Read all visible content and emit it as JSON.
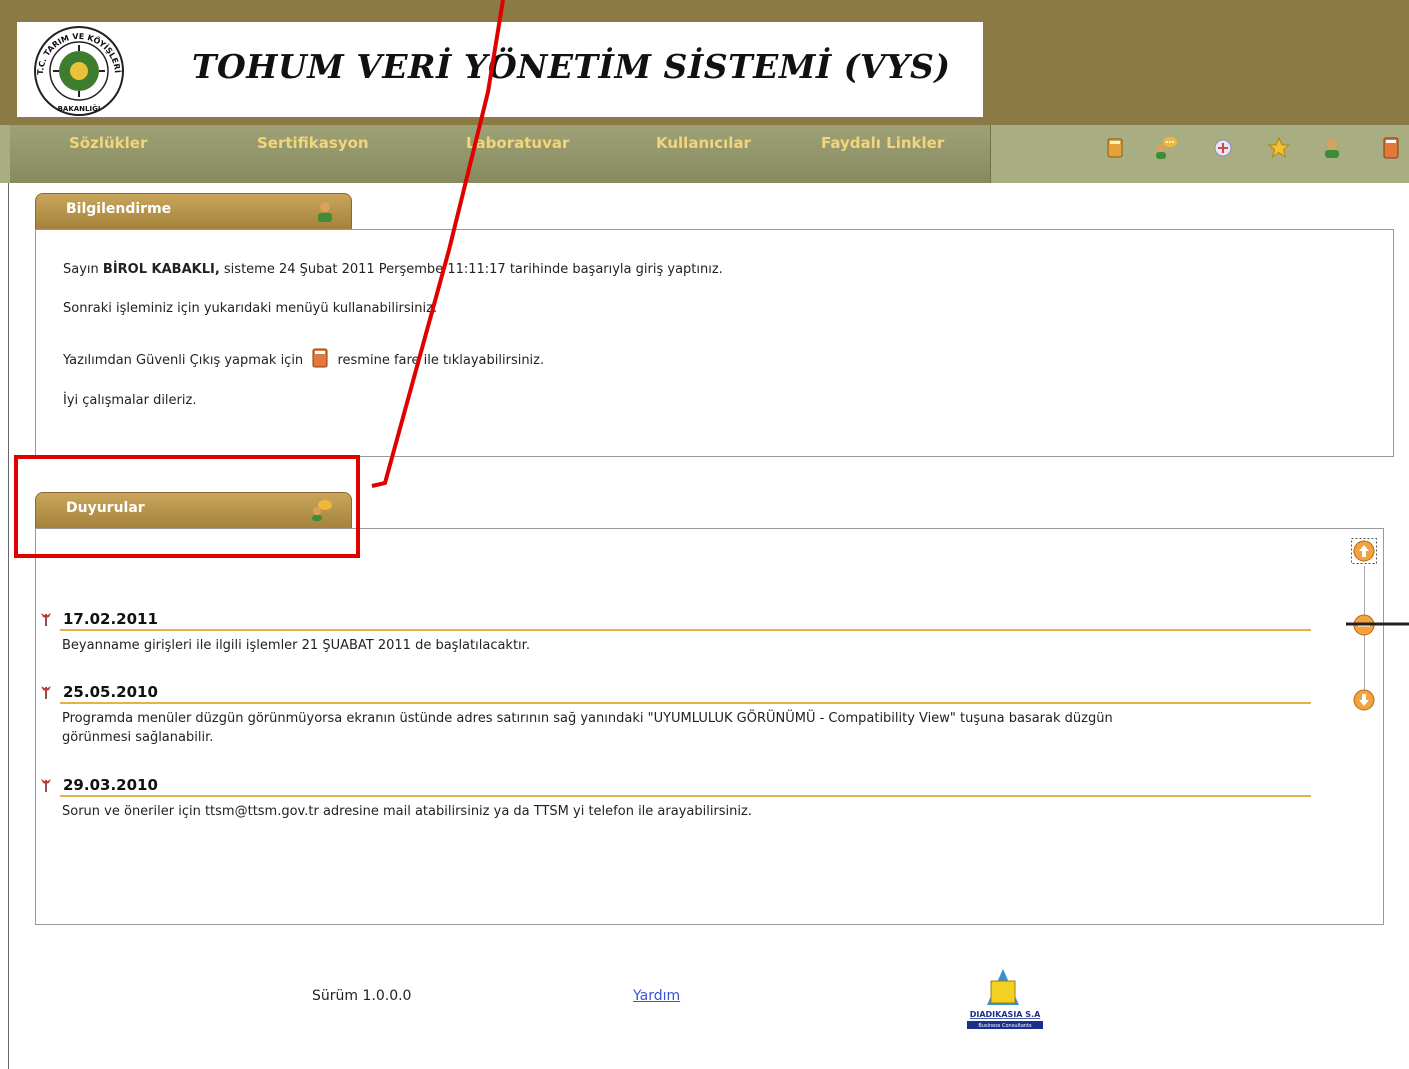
{
  "header": {
    "title": "TOHUM VERİ YÖNETİM SİSTEMİ (VYS)",
    "logo_text_top": "T.C. TARIM VE KÖYİŞLERİ",
    "logo_text_bottom": "BAKANLIĞI"
  },
  "menu": {
    "items": [
      {
        "label": "Sözlükler"
      },
      {
        "label": "Sertifikasyon"
      },
      {
        "label": "Laboratuvar"
      },
      {
        "label": "Kullanıcılar"
      },
      {
        "label": "Faydalı Linkler"
      }
    ],
    "accent_color": "#f1d67c",
    "toolbar_icons": [
      "book-icon",
      "users-chat-icon",
      "link-icon",
      "star-icon",
      "user-icon",
      "exit-icon"
    ]
  },
  "info_panel": {
    "tab_label": "Bilgilendirme",
    "line1_prefix": "Sayın",
    "user_name": "BİROL KABAKLI,",
    "line1_suffix": "sisteme 24 Şubat 2011 Perşembe 11:11:17 tarihinde başarıyla giriş yaptınız.",
    "line2": "Sonraki işleminiz için yukarıdaki menüyü kullanabilirsiniz.",
    "line3_prefix": "Yazılımdan Güvenli Çıkış yapmak için",
    "line3_suffix": "resmine fare ile tıklayabilirsiniz.",
    "line4": "İyi çalışmalar dileriz."
  },
  "announcements_panel": {
    "tab_label": "Duyurular",
    "items": [
      {
        "date": "17.02.2011",
        "lines": [
          "Beyanname girişleri ile ilgili işlemler 21 ŞUABAT 2011 de başlatılacaktır."
        ]
      },
      {
        "date": "25.05.2010",
        "lines": [
          "Programda menüler düzgün görünmüyorsa ekranın üstünde adres satırının sağ yanındaki \"UYUMLULUK GÖRÜNÜMÜ - Compatibility View\" tuşuna basarak düzgün",
          "görünmesi sağlanabilir."
        ]
      },
      {
        "date": "29.03.2010",
        "lines": [
          "Sorun ve öneriler için ttsm@ttsm.gov.tr adresine mail atabilirsiniz ya da TTSM yi telefon ile arayabilirsiniz."
        ]
      }
    ],
    "rule_color": "#e3b24b"
  },
  "footer": {
    "version": "Sürüm 1.0.0.0",
    "help_link": "Yardım",
    "company_name": "DIADIKASIA S.A",
    "company_tagline": "Business Consultants"
  },
  "annotation_color": "#e00000"
}
